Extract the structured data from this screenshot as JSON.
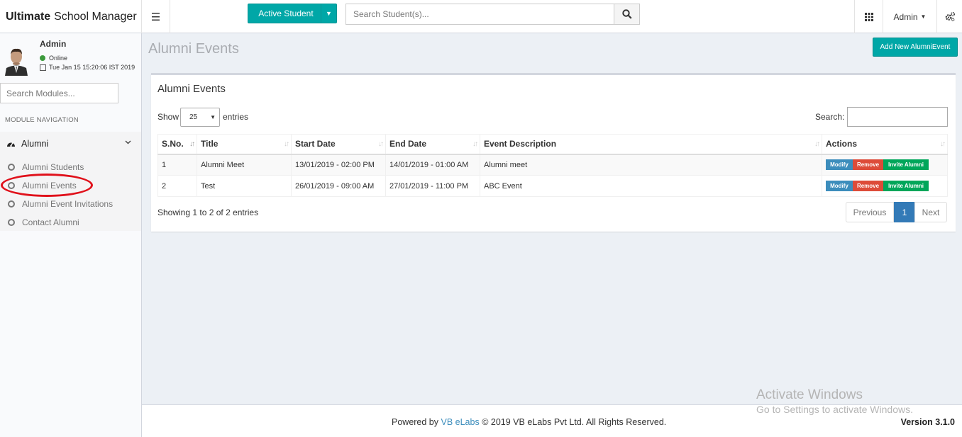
{
  "header": {
    "brand_bold": "Ultimate",
    "brand_rest": "School Manager",
    "active_student_label": "Active Student",
    "search_placeholder": "Search Student(s)...",
    "admin_label": "Admin"
  },
  "sidebar": {
    "user_name": "Admin",
    "status": "Online",
    "datetime": "Tue Jan 15 15:20:06 IST 2019",
    "search_placeholder": "Search Modules...",
    "section_title": "MODULE NAVIGATION",
    "group_label": "Alumni",
    "items": [
      {
        "label": "Alumni Students"
      },
      {
        "label": "Alumni Events"
      },
      {
        "label": "Alumni Event Invitations"
      },
      {
        "label": "Contact Alumni"
      }
    ]
  },
  "content": {
    "page_title": "Alumni Events",
    "add_button_label": "Add New AlumniEvent",
    "box_title": "Alumni Events",
    "show_label": "Show",
    "page_length": "25",
    "entries_label": "entries",
    "search_label": "Search:",
    "table": {
      "columns": [
        "S.No.",
        "Title",
        "Start Date",
        "End Date",
        "Event Description",
        "Actions"
      ],
      "rows": [
        {
          "sno": "1",
          "title": "Alumni Meet",
          "start": "13/01/2019 - 02:00 PM",
          "end": "14/01/2019 - 01:00 AM",
          "desc": "Alumni meet"
        },
        {
          "sno": "2",
          "title": "Test",
          "start": "26/01/2019 - 09:00 AM",
          "end": "27/01/2019 - 11:00 PM",
          "desc": "ABC Event"
        }
      ],
      "actions": {
        "modify": "Modify",
        "remove": "Remove",
        "invite": "Invite Alumni"
      }
    },
    "info": "Showing 1 to 2 of 2 entries",
    "pagination": {
      "previous": "Previous",
      "current": "1",
      "next": "Next"
    }
  },
  "footer": {
    "powered_by": "Powered by",
    "vendor": "VB eLabs",
    "copyright": "© 2019 VB eLabs Pvt Ltd. All Rights Reserved.",
    "version": "Version 3.1.0"
  },
  "watermark": {
    "line1": "Activate Windows",
    "line2": "Go to Settings to activate Windows."
  },
  "colors": {
    "accent_teal": "#00a7a7",
    "modify_blue": "#3c8dbc",
    "remove_red": "#dd4b39",
    "invite_green": "#00a65a",
    "highlight_oval": "#e0111b"
  }
}
